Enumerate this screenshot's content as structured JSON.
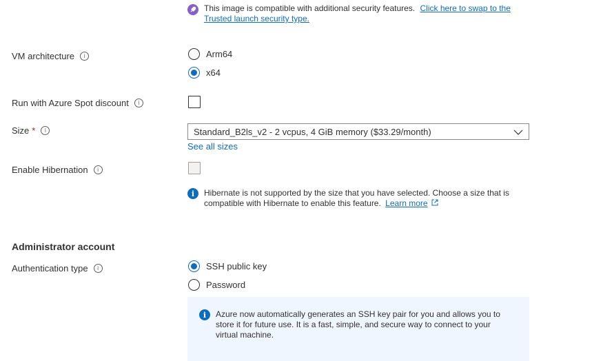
{
  "security_notice": {
    "icon": "rocket-icon",
    "text": "This image is compatible with additional security features.",
    "link_line1": "Click here to swap to the",
    "link_line2": "Trusted launch security type."
  },
  "vm_architecture": {
    "label": "VM architecture",
    "options": [
      {
        "label": "Arm64",
        "checked": false
      },
      {
        "label": "x64",
        "checked": true
      }
    ]
  },
  "spot": {
    "label": "Run with Azure Spot discount",
    "checked": false
  },
  "size": {
    "label": "Size",
    "required_mark": "*",
    "selected": "Standard_B2ls_v2 - 2 vcpus, 4 GiB memory ($33.29/month)",
    "see_all": "See all sizes"
  },
  "hibernation": {
    "label": "Enable Hibernation",
    "checked": false,
    "disabled": true,
    "message_line1": "Hibernate is not supported by the size that you have selected. Choose a size that is",
    "message_line2": "compatible with Hibernate to enable this feature.",
    "learn_more": "Learn more"
  },
  "admin": {
    "heading": "Administrator account",
    "auth_label": "Authentication type",
    "options": [
      {
        "label": "SSH public key",
        "checked": true
      },
      {
        "label": "Password",
        "checked": false
      }
    ],
    "info_line1": "Azure now automatically generates an SSH key pair for you and allows you to",
    "info_line2": "store it for future use. It is a fast, simple, and secure way to connect to your",
    "info_line3": "virtual machine."
  },
  "colors": {
    "accent": "#0f6cbd",
    "info_bg": "#f0f6ff",
    "rocket": "#8661c5"
  }
}
